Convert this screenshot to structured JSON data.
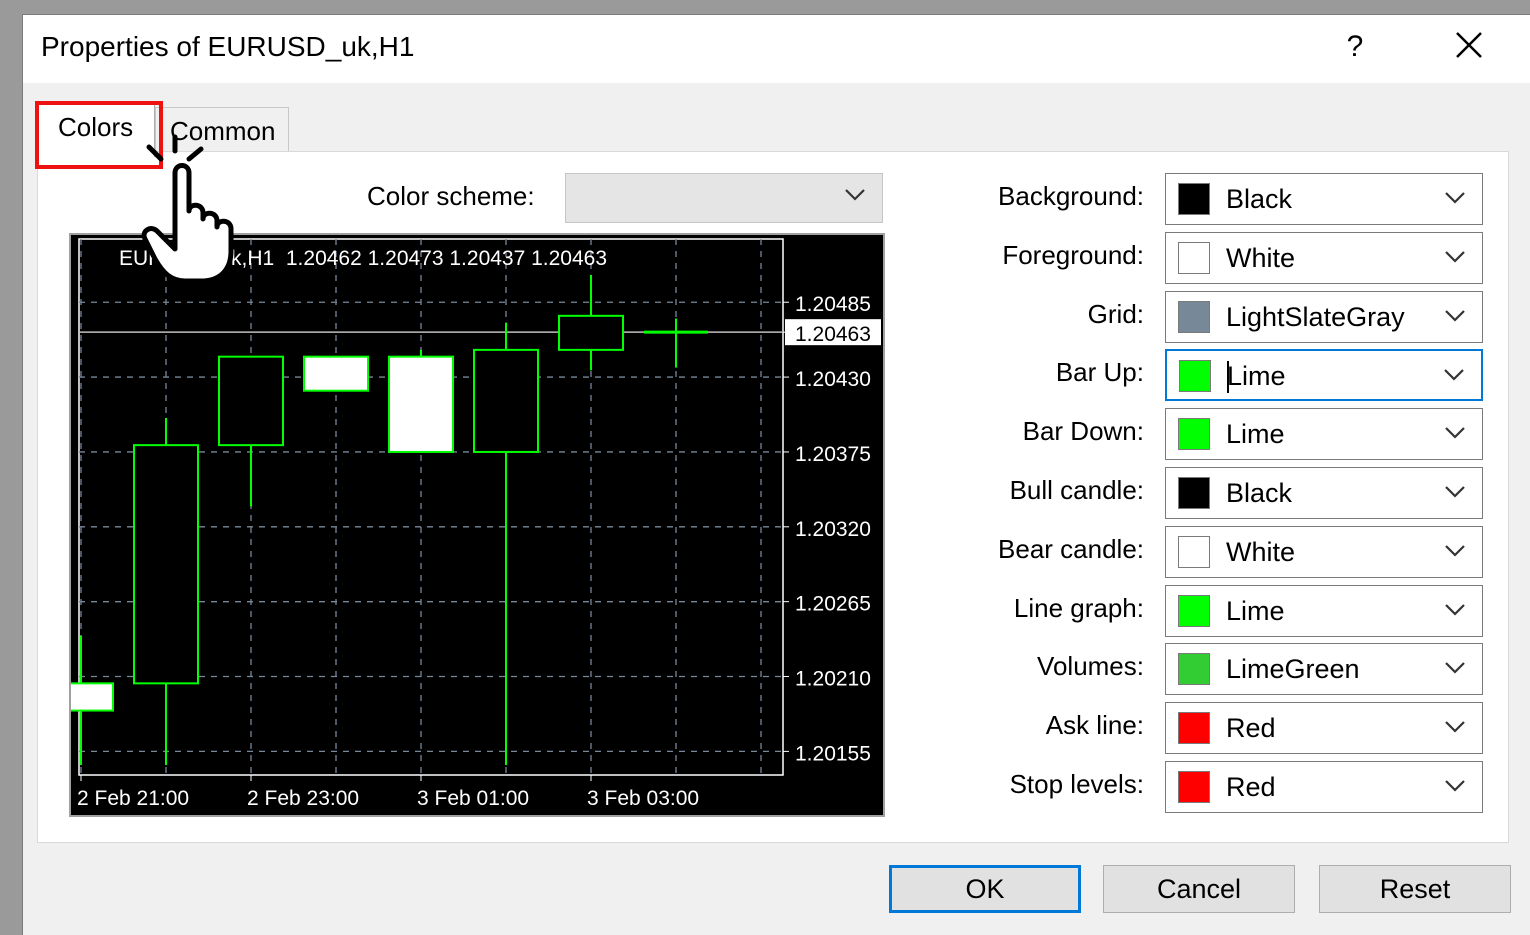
{
  "window": {
    "title": "Properties of EURUSD_uk,H1",
    "help_label": "?",
    "close_icon": "close-icon"
  },
  "tabs": [
    {
      "label": "Colors",
      "active": true
    },
    {
      "label": "Common",
      "active": false
    }
  ],
  "color_scheme": {
    "label": "Color scheme:",
    "value": ""
  },
  "chart_data": {
    "type": "candlestick",
    "symbol": "EURUSD_uk,H1",
    "ohlc_header": "EURUSD_uk,H1  1.20462 1.20473 1.20437 1.20463",
    "price_ticks": [
      "1.20485",
      "1.20463",
      "1.20430",
      "1.20375",
      "1.20320",
      "1.20265",
      "1.20210",
      "1.20155"
    ],
    "time_labels": [
      "2 Feb 21:00",
      "2 Feb 23:00",
      "3 Feb 01:00",
      "3 Feb 03:00"
    ],
    "ylim": [
      1.20145,
      1.20505
    ],
    "current_price": 1.20463,
    "candles": [
      {
        "open": 1.20205,
        "high": 1.2024,
        "low": 1.20145,
        "close": 1.20185
      },
      {
        "open": 1.20205,
        "high": 1.204,
        "low": 1.20145,
        "close": 1.2038
      },
      {
        "open": 1.2038,
        "high": 1.20445,
        "low": 1.20335,
        "close": 1.20445
      },
      {
        "open": 1.20445,
        "high": 1.20445,
        "low": 1.2042,
        "close": 1.2042
      },
      {
        "open": 1.20445,
        "high": 1.2045,
        "low": 1.20375,
        "close": 1.20375
      },
      {
        "open": 1.20375,
        "high": 1.2047,
        "low": 1.20145,
        "close": 1.2045
      },
      {
        "open": 1.2045,
        "high": 1.20505,
        "low": 1.20435,
        "close": 1.20475
      },
      {
        "open": 1.20462,
        "high": 1.20473,
        "low": 1.20437,
        "close": 1.20463
      }
    ],
    "colors": {
      "background": "#000000",
      "foreground": "#ffffff",
      "grid": "#778899",
      "bar_up": "#00ff00",
      "bar_down": "#00ff00",
      "bull_candle": "#000000",
      "bear_candle": "#ffffff"
    }
  },
  "properties": [
    {
      "label": "Background:",
      "value": "Black",
      "color": "#000000"
    },
    {
      "label": "Foreground:",
      "value": "White",
      "color": "#ffffff"
    },
    {
      "label": "Grid:",
      "value": "LightSlateGray",
      "color": "#778899"
    },
    {
      "label": "Bar Up:",
      "value": "Lime",
      "color": "#00ff00",
      "focused": true
    },
    {
      "label": "Bar Down:",
      "value": "Lime",
      "color": "#00ff00"
    },
    {
      "label": "Bull candle:",
      "value": "Black",
      "color": "#000000"
    },
    {
      "label": "Bear candle:",
      "value": "White",
      "color": "#ffffff"
    },
    {
      "label": "Line graph:",
      "value": "Lime",
      "color": "#00ff00"
    },
    {
      "label": "Volumes:",
      "value": "LimeGreen",
      "color": "#32cd32"
    },
    {
      "label": "Ask line:",
      "value": "Red",
      "color": "#ff0000"
    },
    {
      "label": "Stop levels:",
      "value": "Red",
      "color": "#ff0000"
    }
  ],
  "buttons": {
    "ok": "OK",
    "cancel": "Cancel",
    "reset": "Reset"
  }
}
